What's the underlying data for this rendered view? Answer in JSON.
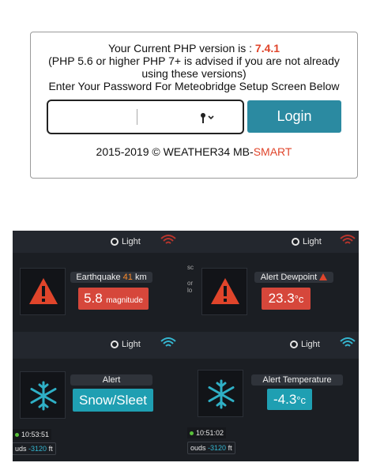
{
  "login": {
    "version_prefix": "Your Current PHP version is : ",
    "version": "7.4.1",
    "advice_line1": "(PHP 5.6 or higher PHP 7+ is advised if you are not already",
    "advice_line2": "using these versions)",
    "prompt": "Enter Your Password For Meteobridge Setup Screen Below",
    "password_value": "",
    "login_label": "Login",
    "footer_prefix": "2015-2019 © WEATHER34 MB-",
    "footer_brand": "SMART"
  },
  "panels": {
    "light_label": "Light",
    "earthquake": {
      "title": "Earthquake",
      "distance": "41",
      "distance_unit": "km",
      "value": "5.8",
      "unit": "magnitude"
    },
    "dewpoint": {
      "title": "Alert Dewpoint",
      "value": "23.3",
      "unit": "°c"
    },
    "snow": {
      "title": "Alert",
      "value": "Snow/Sleet"
    },
    "temperature": {
      "title": "Alert Temperature",
      "value": "-4.3",
      "unit": "°c"
    },
    "left_time": "10:53:51",
    "right_time": "10:51:02",
    "clouds_prefix": "uds ",
    "clouds_prefix_right": "ouds ",
    "clouds_value": "-3120",
    "clouds_unit": "ft",
    "side_text_1": "sc",
    "side_text_2": "or",
    "side_text_3": "lo"
  },
  "colors": {
    "accent_red": "#e0452b",
    "login_button": "#2b8aa1",
    "alert_red": "#d6473b",
    "alert_teal": "#1f9fb2",
    "wifi_red": "#b8352c",
    "wifi_teal": "#35b6d0"
  },
  "icons": {
    "warning": "warning-triangle-icon",
    "snowflake": "snowflake-icon",
    "wifi": "wifi-icon",
    "key": "key-icon"
  }
}
